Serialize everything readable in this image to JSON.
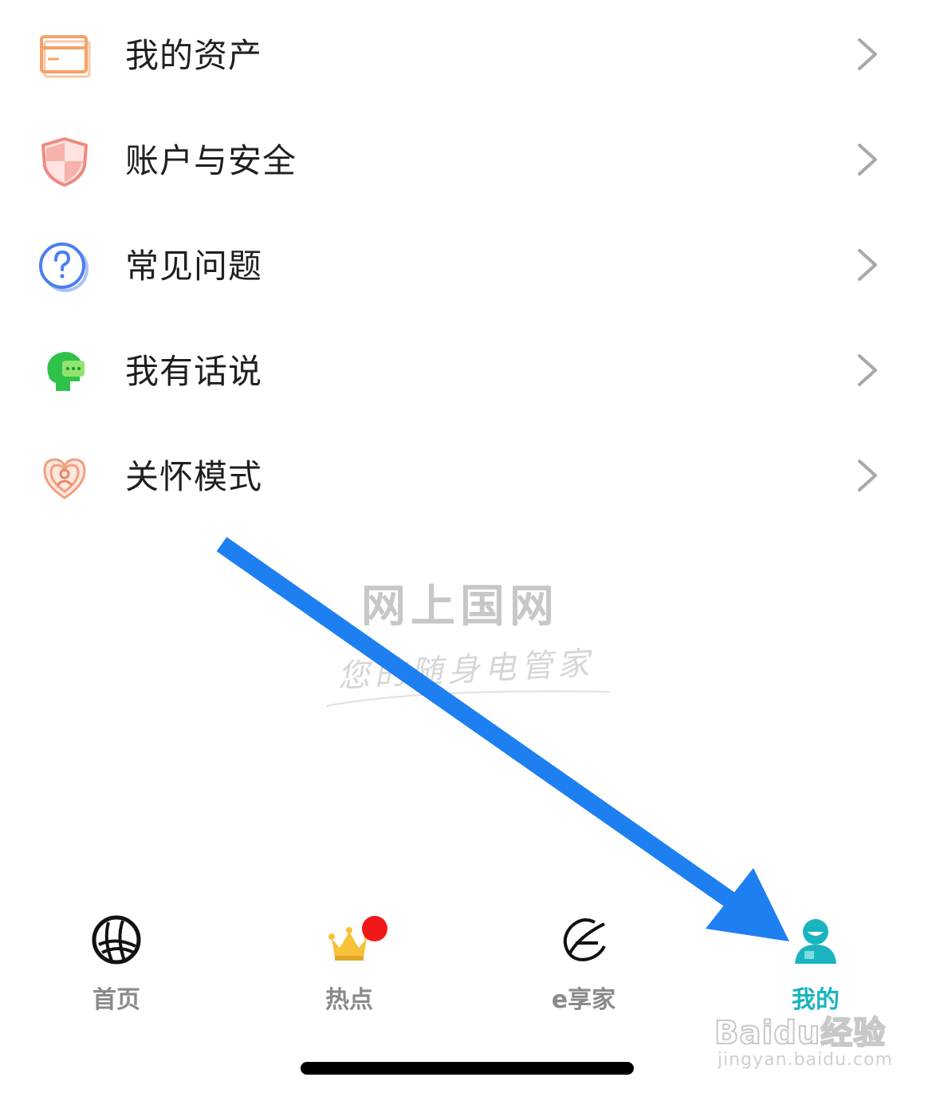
{
  "menu": {
    "items": [
      {
        "label": "我的资产",
        "icon": "wallet-card-icon"
      },
      {
        "label": "账户与安全",
        "icon": "shield-icon"
      },
      {
        "label": "常见问题",
        "icon": "question-circle-icon"
      },
      {
        "label": "我有话说",
        "icon": "head-chat-icon"
      },
      {
        "label": "关怀模式",
        "icon": "heart-person-icon"
      }
    ]
  },
  "watermark": {
    "title": "网上国网",
    "subtitle": "您的随身电管家"
  },
  "tabbar": {
    "active_tab": "我的",
    "active_color": "#19b4bf",
    "tabs": [
      {
        "label": "首页",
        "icon": "globe-icon"
      },
      {
        "label": "热点",
        "icon": "crown-icon",
        "badge": true
      },
      {
        "label": "e享家",
        "icon": "leaf-e-icon"
      },
      {
        "label": "我的",
        "icon": "user-icon",
        "active": true
      }
    ]
  },
  "annotation": {
    "icon": "blue-arrow-icon",
    "color": "#1e7ff0"
  },
  "baidu": {
    "logo": "Baidu经验",
    "url": "jingyan.baidu.com"
  }
}
